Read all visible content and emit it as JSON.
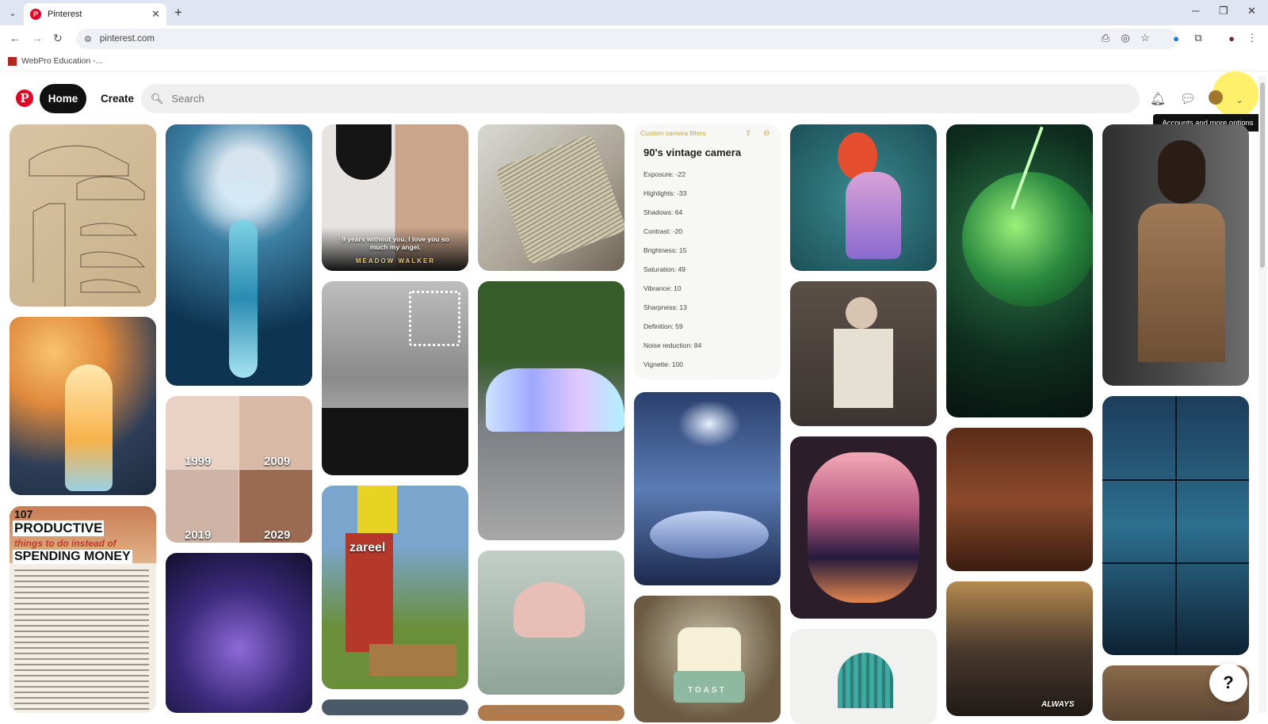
{
  "browser": {
    "tab_title": "Pinterest",
    "tab_favicon": "P",
    "new_tab": "+",
    "url": "pinterest.com",
    "bookmark": "WebPro Education -..."
  },
  "header": {
    "logo": "P",
    "home": "Home",
    "create": "Create",
    "search_placeholder": "Search",
    "tooltip": "Accounts and more options"
  },
  "pins": {
    "quote_text": "9 years without you. I love you so much my angel.",
    "quote_author": "MEADOW WALKER",
    "face_labels": [
      "1999",
      "2009",
      "2019",
      "2029"
    ],
    "productive_number": "107",
    "productive_title": "PRODUCTIVE",
    "productive_subtitle": "things to do instead of",
    "productive_title2": "SPENDING MONEY",
    "minecraft_sign": "zareel",
    "toast_label": "TOAST",
    "movie_caption": "ALWAYS",
    "camera": {
      "back_label": "Custom camera filters",
      "title": "90's vintage camera",
      "rows": [
        "Exposure: -22",
        "Highlights: -33",
        "Shadows: 64",
        "Contrast: -20",
        "Brightness: 15",
        "Saturation: 49",
        "Vibrance: 10",
        "Sharpness: 13",
        "Definition: 59",
        "Noise reduction: 84",
        "Vignette: 100"
      ]
    }
  },
  "help": "?"
}
